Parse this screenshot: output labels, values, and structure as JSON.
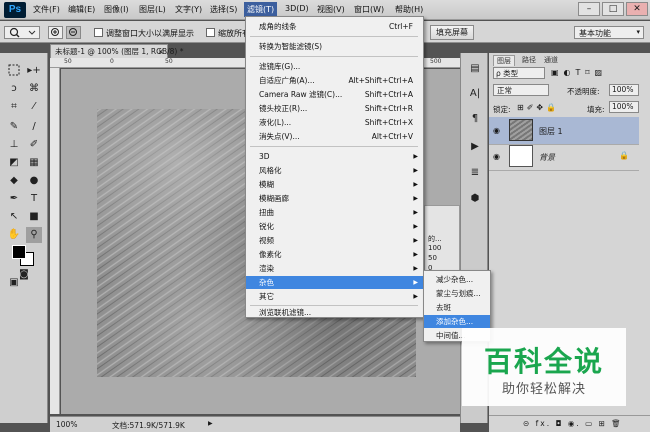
{
  "app": {
    "logo": "Ps"
  },
  "menubar": {
    "items": [
      "文件(F)",
      "编辑(E)",
      "图像(I)",
      "图层(L)",
      "文字(Y)",
      "选择(S)",
      "滤镜(T)",
      "3D(D)",
      "视图(V)",
      "窗口(W)",
      "帮助(H)"
    ],
    "active": "滤镜(T)"
  },
  "window_controls": {
    "minimize": "–",
    "maximize": "□",
    "close": "✕"
  },
  "options": {
    "resize_label": "调整窗口大小以满屏显示",
    "zoom_all_label": "缩放所有",
    "fill_screen": "填充屏幕",
    "workspace": "基本功能"
  },
  "document": {
    "tab_title": "未标题-1 @ 100% (图层 1, RGB/8) *",
    "close": "×",
    "ruler_marks": [
      "50",
      "0",
      "50",
      "500"
    ]
  },
  "status": {
    "zoom": "100%",
    "doc_size": "文档:571.9K/571.9K"
  },
  "filter_menu": {
    "items": [
      {
        "label": "成角的线条",
        "shortcut": "Ctrl+F"
      },
      {
        "label": "转换为智能滤镜(S)"
      },
      {
        "label": "滤镜库(G)..."
      },
      {
        "label": "自适应广角(A)...",
        "shortcut": "Alt+Shift+Ctrl+A"
      },
      {
        "label": "Camera Raw 滤镜(C)...",
        "shortcut": "Shift+Ctrl+A"
      },
      {
        "label": "镜头校正(R)...",
        "shortcut": "Shift+Ctrl+R"
      },
      {
        "label": "液化(L)...",
        "shortcut": "Shift+Ctrl+X"
      },
      {
        "label": "消失点(V)...",
        "shortcut": "Alt+Ctrl+V"
      },
      {
        "label": "3D"
      },
      {
        "label": "风格化"
      },
      {
        "label": "模糊"
      },
      {
        "label": "模糊画廊"
      },
      {
        "label": "扭曲"
      },
      {
        "label": "锐化"
      },
      {
        "label": "视频"
      },
      {
        "label": "像素化"
      },
      {
        "label": "渲染"
      },
      {
        "label": "杂色"
      },
      {
        "label": "其它"
      },
      {
        "label": "浏览联机滤镜..."
      }
    ],
    "highlighted": "杂色"
  },
  "noise_submenu": {
    "items": [
      "减少杂色...",
      "蒙尘与划痕...",
      "去斑",
      "添加杂色...",
      "中间值..."
    ],
    "highlighted": "添加杂色..."
  },
  "layers_panel": {
    "tabs": [
      "图层",
      "路径",
      "通道"
    ],
    "kind_filter": "ρ 类型",
    "blend_mode": "正常",
    "opacity_label": "不透明度:",
    "opacity": "100%",
    "lock_label": "锁定:",
    "fill_label": "填充:",
    "fill": "100%",
    "layers": [
      {
        "name": "图层 1",
        "selected": true
      },
      {
        "name": "背景",
        "locked": true
      }
    ],
    "footer_icons": "⊝  fx.  ◘  ◉.  ▭  ⊞  🗑"
  },
  "partial_panel": {
    "lines": [
      "的...",
      "100",
      "50",
      "0"
    ]
  },
  "watermark": {
    "title": "百科全说",
    "subtitle": "助你轻松解决"
  }
}
